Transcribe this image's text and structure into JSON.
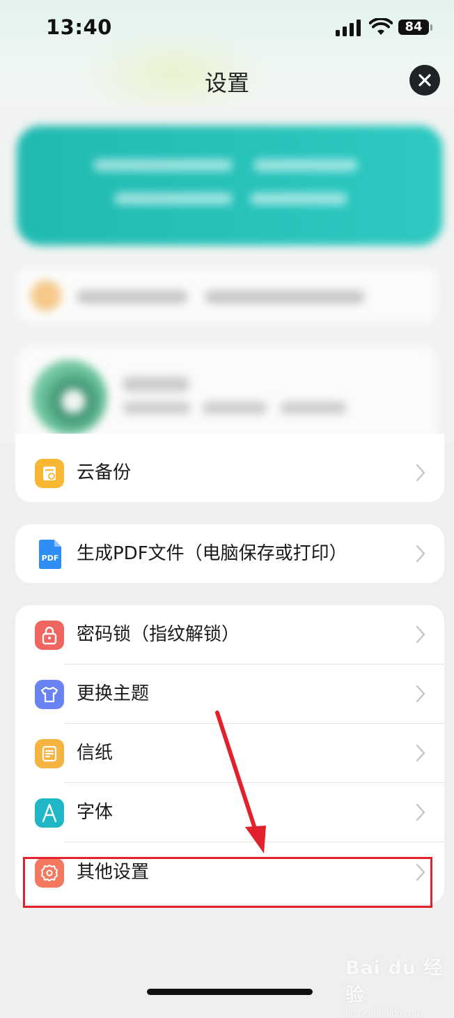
{
  "status_bar": {
    "time": "13:40",
    "battery": "84"
  },
  "header": {
    "title": "设置"
  },
  "menu": {
    "cloud_backup": "云备份",
    "generate_pdf": "生成PDF文件（电脑保存或打印）",
    "password_lock": "密码锁（指纹解锁）",
    "change_theme": "更换主题",
    "letter_paper": "信纸",
    "font": "字体",
    "other_settings": "其他设置"
  },
  "icons": {
    "cloud_backup": "cloud-backup-icon",
    "generate_pdf": "pdf-file-icon",
    "password_lock": "lock-icon",
    "change_theme": "tshirt-icon",
    "letter_paper": "note-paper-icon",
    "font": "font-a-icon",
    "other_settings": "gear-icon"
  },
  "colors": {
    "cloud_backup": "#f7b733",
    "generate_pdf": "#2f8ef3",
    "password_lock": "#ef6660",
    "change_theme": "#6a83f2",
    "letter_paper": "#f5b441",
    "font": "#1fb7c6",
    "other_settings": "#f2785f",
    "highlight": "#e1212c"
  },
  "watermark": {
    "brand": "Bai du 经验",
    "sub": "jingyan.baidu.com"
  }
}
